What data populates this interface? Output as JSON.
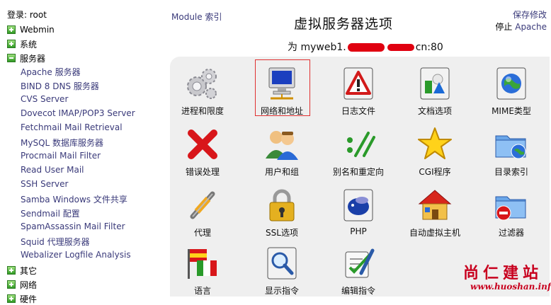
{
  "login": "登录: root",
  "sidebar": {
    "categories": [
      {
        "label": "Webmin"
      },
      {
        "label": "系统"
      },
      {
        "label": "服务器"
      },
      {
        "label": "其它"
      },
      {
        "label": "网络"
      },
      {
        "label": "硬件"
      }
    ],
    "servers": [
      "Apache 服务器",
      "BIND 8 DNS 服务器",
      "CVS Server",
      "Dovecot IMAP/POP3 Server",
      "Fetchmail Mail Retrieval",
      "MySQL 数据库服务器",
      "Procmail Mail Filter",
      "Read User Mail",
      "SSH Server",
      "Samba Windows 文件共享",
      "Sendmail 配置",
      "SpamAssassin Mail Filter",
      "Squid 代理服务器",
      "Webalizer Logfile Analysis"
    ]
  },
  "header": {
    "module_index": "Module 索引",
    "title": "虚拟服务器选项",
    "server_prefix": "为",
    "server_a": "myweb1.",
    "server_b": "cn:80",
    "save_label": "保存修改",
    "stop_label": "停止",
    "stop_link": "Apache"
  },
  "options": [
    {
      "label": "进程和限度",
      "icon": "gears-icon"
    },
    {
      "label": "网络和地址",
      "icon": "network-computer-icon"
    },
    {
      "label": "日志文件",
      "icon": "log-warning-icon"
    },
    {
      "label": "文档选项",
      "icon": "document-options-icon"
    },
    {
      "label": "MIME类型",
      "icon": "mime-globe-icon"
    },
    {
      "label": "错误处理",
      "icon": "error-x-icon"
    },
    {
      "label": "用户和组",
      "icon": "users-icon"
    },
    {
      "label": "别名和重定向",
      "icon": "alias-icon"
    },
    {
      "label": "CGI程序",
      "icon": "star-icon"
    },
    {
      "label": "目录索引",
      "icon": "folder-globe-icon"
    },
    {
      "label": "代理",
      "icon": "proxy-icon"
    },
    {
      "label": "SSL选项",
      "icon": "padlock-icon"
    },
    {
      "label": "PHP",
      "icon": "php-icon"
    },
    {
      "label": "自动虚拟主机",
      "icon": "house-icon"
    },
    {
      "label": "过滤器",
      "icon": "folder-filter-icon"
    },
    {
      "label": "语言",
      "icon": "flags-icon"
    },
    {
      "label": "显示指令",
      "icon": "magnifier-icon"
    },
    {
      "label": "编辑指令",
      "icon": "edit-icon"
    }
  ],
  "watermark": {
    "zh": "尚仁建站",
    "url": "www.huoshan.info"
  },
  "colors": {
    "panel": "#efefef",
    "link": "#3a3a7a",
    "selection": "#e03030",
    "watermark": "#c8001e"
  }
}
